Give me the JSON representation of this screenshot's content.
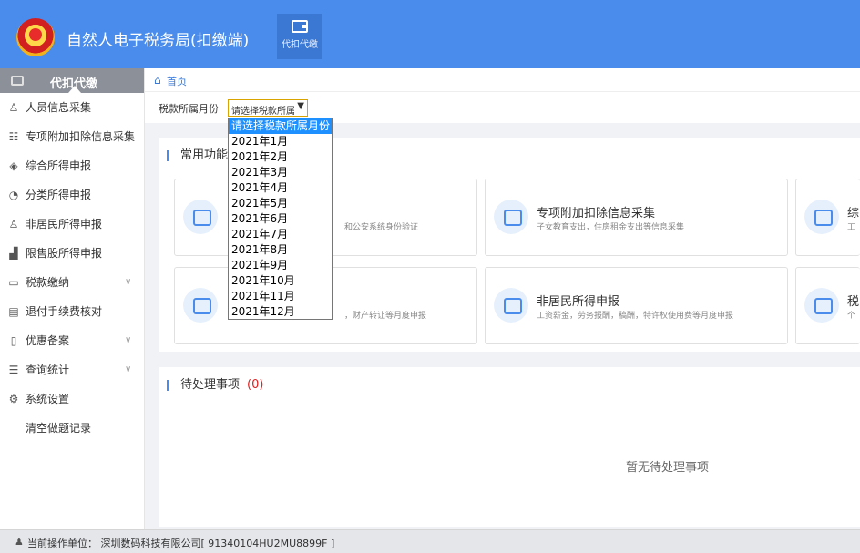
{
  "header": {
    "app_title": "自然人电子税务局(扣缴端)",
    "top_tab": {
      "label": "代扣代缴",
      "icon": "wallet-icon"
    }
  },
  "sidebar": {
    "heading": "代扣代缴",
    "items": [
      {
        "label": "人员信息采集",
        "icon": "person-icon"
      },
      {
        "label": "专项附加扣除信息采集",
        "icon": "list-icon"
      },
      {
        "label": "综合所得申报",
        "icon": "layers-icon"
      },
      {
        "label": "分类所得申报",
        "icon": "pie-clock-icon"
      },
      {
        "label": "非居民所得申报",
        "icon": "person-outline-icon"
      },
      {
        "label": "限售股所得申报",
        "icon": "bar-chart-icon"
      },
      {
        "label": "税款缴纳",
        "icon": "folder-icon",
        "expandable": true
      },
      {
        "label": "退付手续费核对",
        "icon": "receipt-icon"
      },
      {
        "label": "优惠备案",
        "icon": "document-icon",
        "expandable": true
      },
      {
        "label": "查询统计",
        "icon": "search-list-icon",
        "expandable": true
      },
      {
        "label": "系统设置",
        "icon": "gear-icon"
      },
      {
        "label": "清空做题记录",
        "icon": ""
      }
    ]
  },
  "breadcrumb": {
    "home": "首页"
  },
  "filter": {
    "label": "税款所属月份",
    "selected": "请选择税款所属"
  },
  "dropdown": {
    "options": [
      "请选择税款所属月份",
      "2021年1月",
      "2021年2月",
      "2021年3月",
      "2021年4月",
      "2021年5月",
      "2021年6月",
      "2021年7月",
      "2021年8月",
      "2021年9月",
      "2021年10月",
      "2021年11月",
      "2021年12月"
    ]
  },
  "common": {
    "title": "常用功能",
    "cards": [
      {
        "title": "",
        "desc": "和公安系统身份验证"
      },
      {
        "title": "专项附加扣除信息采集",
        "desc": "子女教育支出，住房租金支出等信息采集"
      },
      {
        "title": "综",
        "desc": "工"
      },
      {
        "title": "",
        "desc": "，财产转让等月度申报"
      },
      {
        "title": "非居民所得申报",
        "desc": "工资薪金，劳务报酬，稿酬，特许权使用费等月度申报"
      },
      {
        "title": "税",
        "desc": "个"
      }
    ]
  },
  "pending": {
    "title": "待处理事项",
    "count": "(0)",
    "empty": "暂无待处理事项"
  },
  "footer": {
    "text": "当前操作单位： 深圳数码科技有限公司[ 91340104HU2MU8899F ]"
  }
}
